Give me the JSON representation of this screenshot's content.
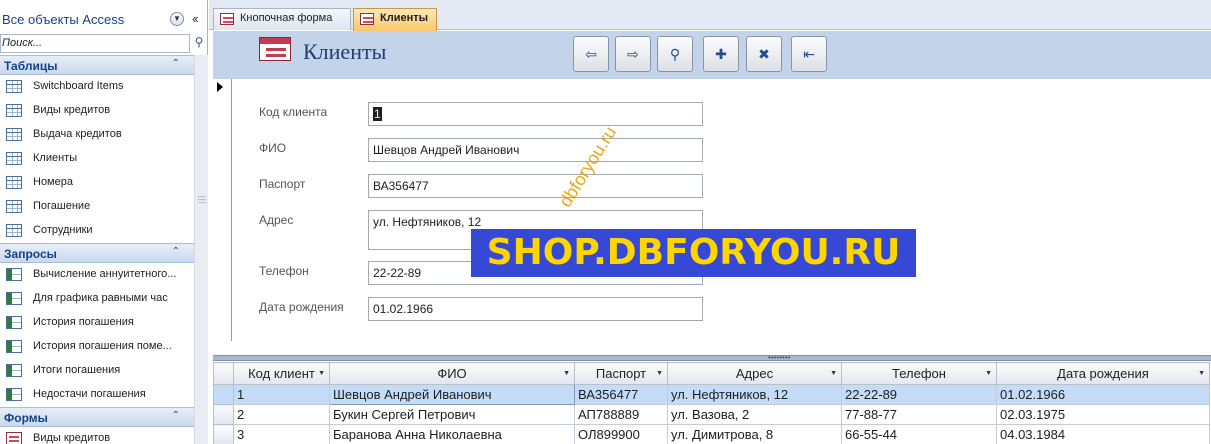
{
  "nav": {
    "title": "Все объекты Access",
    "search_placeholder": "Поиск...",
    "groups": [
      {
        "label": "Таблицы",
        "type": "table",
        "items": [
          "Switchboard Items",
          "Виды кредитов",
          "Выдача кредитов",
          "Клиенты",
          "Номера",
          "Погашение",
          "Сотрудники"
        ]
      },
      {
        "label": "Запросы",
        "type": "query",
        "items": [
          "Вычисление аннуитетного...",
          "Для графика равными час",
          "История погашения",
          "История погашения поме...",
          "Итоги погашения",
          "Недостачи погашения"
        ]
      },
      {
        "label": "Формы",
        "type": "form",
        "items": [
          "Виды кредитов"
        ]
      }
    ]
  },
  "tabs": [
    {
      "label": "Кнопочная форма",
      "active": false
    },
    {
      "label": "Клиенты",
      "active": true
    }
  ],
  "form": {
    "title": "Клиенты",
    "toolbar": [
      {
        "name": "prev-record-button",
        "icon": "arrow-left-icon",
        "glyph": "⇦"
      },
      {
        "name": "next-record-button",
        "icon": "arrow-right-icon",
        "glyph": "⇨"
      },
      {
        "name": "find-button",
        "icon": "binoculars-icon",
        "glyph": "⚲"
      },
      {
        "name": "new-record-button",
        "icon": "new-record-icon",
        "glyph": "✚"
      },
      {
        "name": "delete-record-button",
        "icon": "delete-record-icon",
        "glyph": "✖"
      },
      {
        "name": "close-form-button",
        "icon": "exit-door-icon",
        "glyph": "⇤"
      }
    ],
    "fields": {
      "id": {
        "label": "Код клиента",
        "value": "1"
      },
      "fio": {
        "label": "ФИО",
        "value": "Шевцов Андрей Иванович"
      },
      "passport": {
        "label": "Паспорт",
        "value": "ВА356477"
      },
      "address": {
        "label": "Адрес",
        "value": "ул. Нефтяников, 12"
      },
      "phone": {
        "label": "Телефон",
        "value": "22-22-89"
      },
      "birth": {
        "label": "Дата рождения",
        "value": "01.02.1966"
      }
    }
  },
  "datasheet": {
    "columns": [
      "Код клиент",
      "ФИО",
      "Паспорт",
      "Адрес",
      "Телефон",
      "Дата рождения"
    ],
    "rows": [
      [
        "1",
        "Шевцов Андрей Иванович",
        "ВА356477",
        "ул. Нефтяников, 12",
        "22-22-89",
        "01.02.1966"
      ],
      [
        "2",
        "Букин Сергей Петрович",
        "АП788889",
        "ул. Вазова, 2",
        "77-88-77",
        "02.03.1975"
      ],
      [
        "3",
        "Баранова Анна Николаевна",
        "ОЛ899900",
        "ул. Димитрова, 8",
        "66-55-44",
        "04.03.1984"
      ]
    ]
  },
  "watermark": {
    "banner": "SHOP.DBFORYOU.RU",
    "diagonal": "dbforyou.ru"
  },
  "colors": {
    "accent": "#15428b",
    "active_tab": "#f8c76a",
    "banner_bg": "#3549d6",
    "banner_text": "#ffd500"
  }
}
